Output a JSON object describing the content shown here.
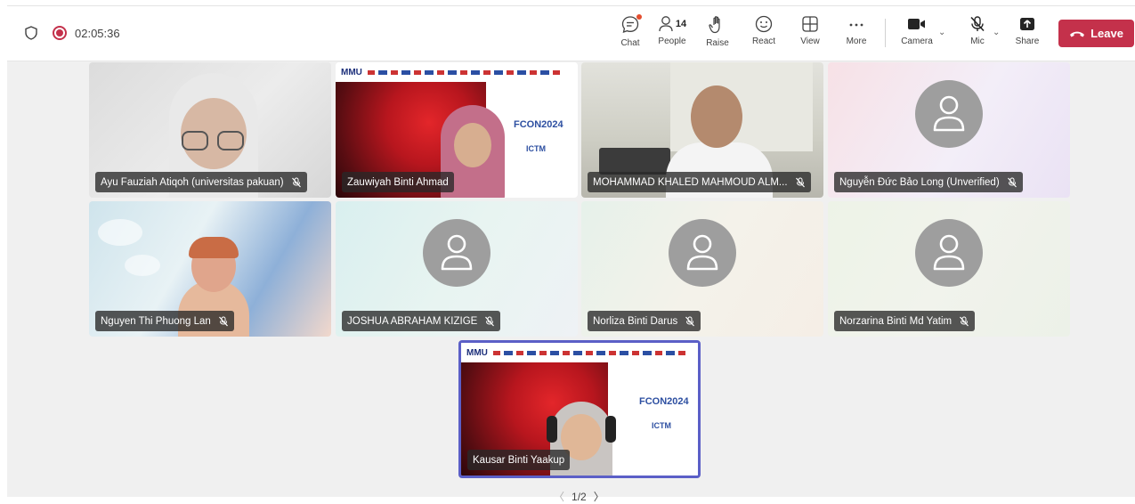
{
  "status": {
    "recording_time": "02:05:36"
  },
  "toolbar": {
    "chat": "Chat",
    "people": "People",
    "people_count": "14",
    "raise": "Raise",
    "react": "React",
    "view": "View",
    "more": "More",
    "camera": "Camera",
    "mic": "Mic",
    "share": "Share",
    "leave": "Leave"
  },
  "participants": [
    {
      "name": "Ayu Fauziah Atiqoh (universitas pakuan)",
      "type": "video"
    },
    {
      "name": "Zauwiyah Binti Ahmad",
      "type": "video-slide"
    },
    {
      "name": "MOHAMMAD KHALED MAHMOUD ALM...",
      "type": "video"
    },
    {
      "name": "Nguyễn Đức Bảo Long (Unverified)",
      "type": "avatar"
    },
    {
      "name": "Nguyen Thi Phuong Lan",
      "type": "video"
    },
    {
      "name": "JOSHUA ABRAHAM KIZIGE",
      "type": "avatar"
    },
    {
      "name": "Norliza Binti Darus",
      "type": "avatar"
    },
    {
      "name": "Norzarina Binti Md Yatim",
      "type": "avatar"
    },
    {
      "name": "Kausar Binti Yaakup",
      "type": "video-slide",
      "active_speaker": true
    }
  ],
  "slide": {
    "brand": "MMU",
    "conference": "FCON2024",
    "org": "ICTM"
  },
  "pagination": {
    "label": "1/2"
  },
  "colors": {
    "leave": "#c4314b",
    "active_border": "#5b5fc7",
    "recording": "#c4314b"
  }
}
